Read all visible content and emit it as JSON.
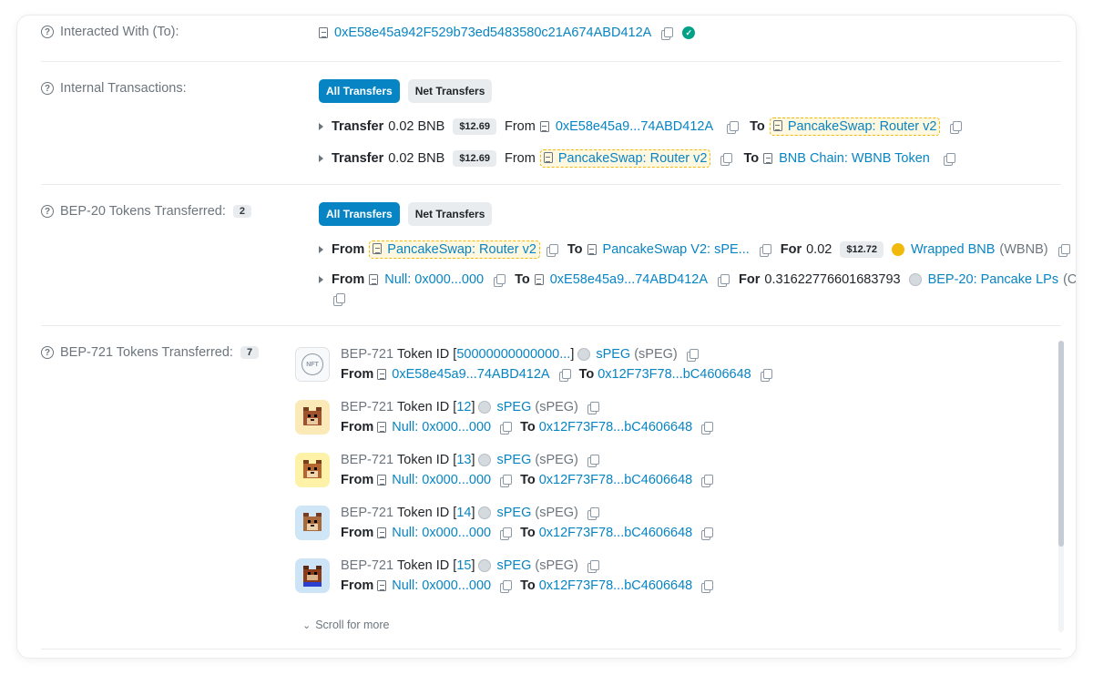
{
  "interacted": {
    "label": "Interacted With (To):",
    "address": "0xE58e45a942F529b73ed5483580c21A674ABD412A"
  },
  "internal": {
    "label": "Internal Transactions:",
    "tab_all": "All Transfers",
    "tab_net": "Net Transfers",
    "rows": [
      {
        "transfer": "Transfer",
        "amount": "0.02 BNB",
        "usd": "$12.69",
        "from_label": "From",
        "from": "0xE58e45a9...74ABD412A",
        "to_label": "To",
        "to": "PancakeSwap: Router v2"
      },
      {
        "transfer": "Transfer",
        "amount": "0.02 BNB",
        "usd": "$12.69",
        "from_label": "From",
        "from": "PancakeSwap: Router v2",
        "to_label": "To",
        "to": "BNB Chain: WBNB Token"
      }
    ]
  },
  "bep20": {
    "label": "BEP-20 Tokens Transferred:",
    "count": "2",
    "tab_all": "All Transfers",
    "tab_net": "Net Transfers",
    "rows": [
      {
        "from_label": "From",
        "from": "PancakeSwap: Router v2",
        "to_label": "To",
        "to": "PancakeSwap V2: sPE...",
        "for_label": "For",
        "amount": "0.02",
        "usd": "$12.72",
        "token": "Wrapped BNB",
        "symbol": "(WBNB)"
      },
      {
        "from_label": "From",
        "from": "Null: 0x000...000",
        "to_label": "To",
        "to": "0xE58e45a9...74ABD412A",
        "for_label": "For",
        "amount": "0.31622776601683793",
        "token": "BEP-20: Pancake LPs",
        "symbol": "(Cake-L...)"
      }
    ]
  },
  "bep721": {
    "label": "BEP-721 Tokens Transferred:",
    "count": "7",
    "thumb_text": "NFT",
    "items": [
      {
        "standard": "BEP-721",
        "token_id_label": "Token ID",
        "token_id": "50000000000000...",
        "collection": "sPEG",
        "symbol": "(sPEG)",
        "from_label": "From",
        "from": "0xE58e45a9...74ABD412A",
        "to_label": "To",
        "to": "0x12F73F78...bC4606648"
      },
      {
        "standard": "BEP-721",
        "token_id_label": "Token ID",
        "token_id": "12",
        "collection": "sPEG",
        "symbol": "(sPEG)",
        "from_label": "From",
        "from": "Null: 0x000...000",
        "to_label": "To",
        "to": "0x12F73F78...bC4606648"
      },
      {
        "standard": "BEP-721",
        "token_id_label": "Token ID",
        "token_id": "13",
        "collection": "sPEG",
        "symbol": "(sPEG)",
        "from_label": "From",
        "from": "Null: 0x000...000",
        "to_label": "To",
        "to": "0x12F73F78...bC4606648"
      },
      {
        "standard": "BEP-721",
        "token_id_label": "Token ID",
        "token_id": "14",
        "collection": "sPEG",
        "symbol": "(sPEG)",
        "from_label": "From",
        "from": "Null: 0x000...000",
        "to_label": "To",
        "to": "0x12F73F78...bC4606648"
      },
      {
        "standard": "BEP-721",
        "token_id_label": "Token ID",
        "token_id": "15",
        "collection": "sPEG",
        "symbol": "(sPEG)",
        "from_label": "From",
        "from": "Null: 0x000...000",
        "to_label": "To",
        "to": "0x12F73F78...bC4606648"
      }
    ],
    "scroll_more": "Scroll for more"
  },
  "colors": {
    "link": "#0784c3",
    "accent_button": "#0784c3",
    "highlight_border": "#f0b90b",
    "verified": "#00a186"
  }
}
